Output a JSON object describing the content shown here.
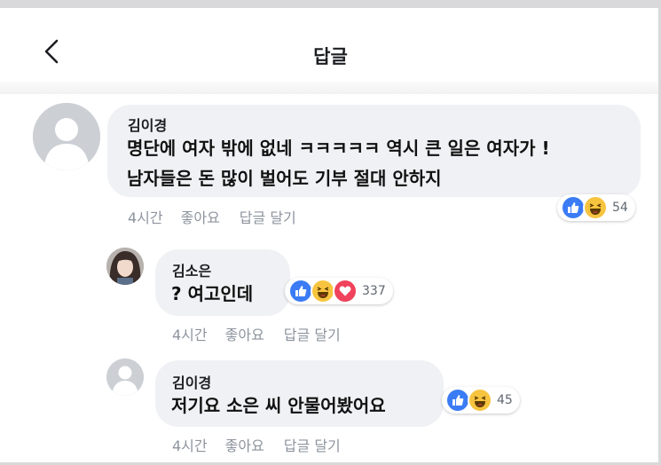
{
  "header": {
    "title": "답글",
    "back_icon": "chevron-left-icon"
  },
  "colors": {
    "like": "#3b7cf5",
    "haha": "#f7c440",
    "love": "#f0425c",
    "bubble": "#f0f1f4"
  },
  "comments": [
    {
      "author": "김이경",
      "lines": [
        "명단에 여자 밖에 없네 ㅋㅋㅋㅋㅋ 역시 큰 일은 여자가 !",
        "남자들은 돈 많이 벌어도 기부 절대 안하지"
      ],
      "time": "4시간",
      "like": "좋아요",
      "reply": "답글 달기",
      "reactions": [
        "like-icon",
        "haha-icon"
      ],
      "reaction_count": "54"
    },
    {
      "author": "김소은",
      "lines": [
        "? 여고인데"
      ],
      "time": "4시간",
      "like": "좋아요",
      "reply": "답글 달기",
      "reactions": [
        "like-icon",
        "haha-icon",
        "love-icon"
      ],
      "reaction_count": "337"
    },
    {
      "author": "김이경",
      "lines": [
        "저기요 소은 씨 안물어봤어요"
      ],
      "time": "4시간",
      "like": "좋아요",
      "reply": "답글 달기",
      "reactions": [
        "like-icon",
        "haha-icon"
      ],
      "reaction_count": "45"
    }
  ]
}
